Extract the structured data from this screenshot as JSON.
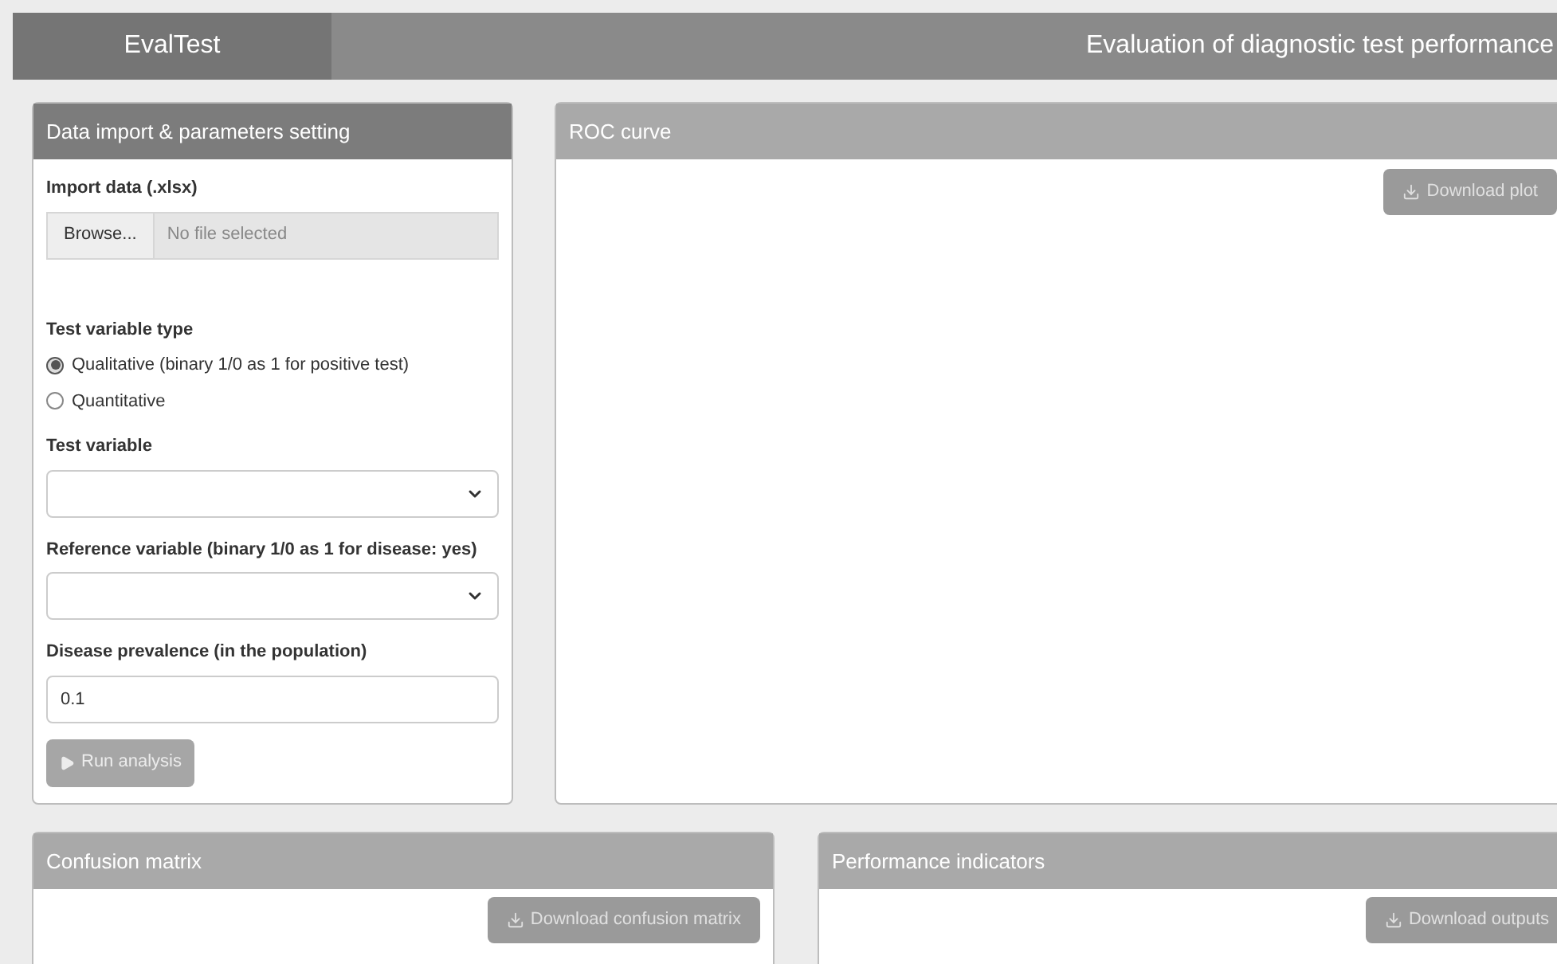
{
  "navbar": {
    "brand": "EvalTest",
    "title": "Evaluation of diagnostic test performance"
  },
  "sidebar": {
    "title": "Data import & parameters setting",
    "file_input": {
      "label": "Import data (.xlsx)",
      "button": "Browse...",
      "placeholder": "No file selected"
    },
    "radio_group": {
      "label": "Test variable type",
      "options": [
        {
          "label": "Qualitative (binary 1/0 as 1 for positive test)",
          "selected": true
        },
        {
          "label": "Quantitative",
          "selected": false
        }
      ]
    },
    "selects": [
      {
        "label": "Test variable"
      },
      {
        "label": "Reference variable (binary 1/0 as 1 for disease: yes)"
      }
    ],
    "prevalence": {
      "label": "Disease prevalence (in the population)",
      "value": "0.1"
    },
    "run_button": {
      "label": "Run analysis",
      "disabled": true
    }
  },
  "roc_panel": {
    "title": "ROC curve",
    "button": {
      "label": "Download plot",
      "disabled": true
    }
  },
  "bottom_panels": [
    {
      "title": "Confusion matrix",
      "button": {
        "label": "Download confusion matrix",
        "disabled": true
      }
    },
    {
      "title": "Performance indicators",
      "button": {
        "label": "Download outputs",
        "disabled": true
      }
    }
  ]
}
